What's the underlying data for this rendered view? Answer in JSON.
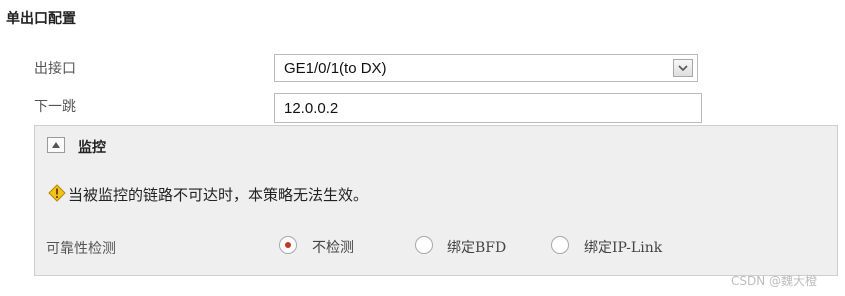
{
  "section": {
    "title": "单出口配置"
  },
  "form": {
    "exit_interface": {
      "label": "出接口",
      "value": "GE1/0/1(to DX)"
    },
    "next_hop": {
      "label": "下一跳",
      "value": "12.0.0.2"
    }
  },
  "monitor": {
    "title": "监控",
    "warning": "当被监控的链路不可达时，本策略无法生效。",
    "detection": {
      "label": "可靠性检测",
      "options": [
        {
          "label": "不检测",
          "checked": true
        },
        {
          "label": "绑定BFD",
          "checked": false
        },
        {
          "label": "绑定IP-Link",
          "checked": false
        }
      ]
    }
  },
  "watermark": "CSDN @魏大橙",
  "colors": {
    "panel_bg": "#efefef",
    "radio_selected": "#c0392b",
    "warning_icon": "#f0c419"
  }
}
